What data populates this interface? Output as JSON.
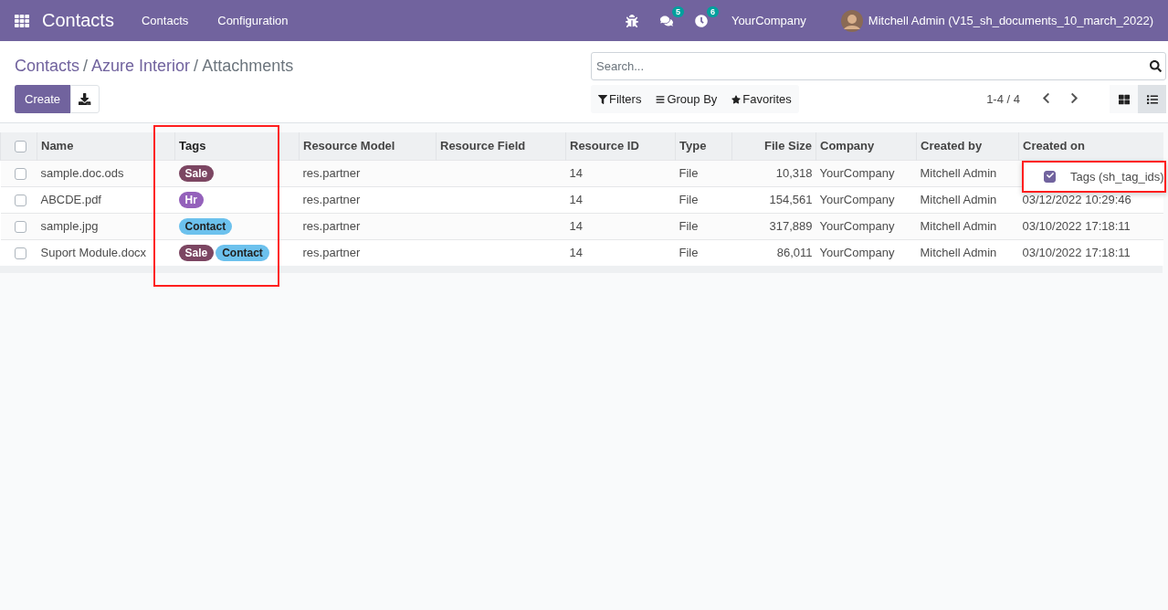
{
  "navbar": {
    "app_title": "Contacts",
    "menu": [
      "Contacts",
      "Configuration"
    ],
    "messages_badge": "5",
    "activities_badge": "6",
    "company": "YourCompany",
    "user": "Mitchell Admin (V15_sh_documents_10_march_2022)"
  },
  "breadcrumb": [
    {
      "label": "Contacts",
      "link": true
    },
    {
      "separator": "/",
      "label": "Azure Interior",
      "link": true
    },
    {
      "separator": "/",
      "label": "Attachments",
      "link": false
    }
  ],
  "create_button": "Create",
  "search": {
    "placeholder": "Search..."
  },
  "filters": [
    "Filters",
    "Group By",
    "Favorites"
  ],
  "pager": "1-4 / 4",
  "views": [
    {
      "kind": "kanban",
      "selected": false
    },
    {
      "kind": "list",
      "selected": true
    }
  ],
  "table": {
    "select_all": {
      "checked": false
    },
    "columns": [
      {
        "kind": "text",
        "label": "Name",
        "highlight": false
      },
      {
        "kind": "tags",
        "label": "Tags",
        "highlight": true
      },
      {
        "kind": "text",
        "label": "Resource Model",
        "highlight": false
      },
      {
        "kind": "text",
        "label": "Resource Field",
        "highlight": false
      },
      {
        "kind": "text",
        "label": "Resource ID",
        "highlight": false
      },
      {
        "kind": "text",
        "label": "Type",
        "highlight": false
      },
      {
        "kind": "number",
        "label": "File Size",
        "highlight": false
      },
      {
        "kind": "text",
        "label": "Company",
        "highlight": false
      },
      {
        "kind": "text",
        "label": "Created by",
        "highlight": false
      },
      {
        "kind": "text",
        "label": "Created on",
        "highlight": false
      }
    ],
    "rows": [
      {
        "checked": false,
        "cells": [
          "sample.doc.ods",
          [
            {
              "label": "Sale",
              "color": "#7c4662"
            }
          ],
          "res.partner",
          null,
          "14",
          "File",
          "10,318",
          "YourCompany",
          "Mitchell Admin",
          null
        ]
      },
      {
        "checked": false,
        "cells": [
          "ABCDE.pdf",
          [
            {
              "label": "Hr",
              "color": "#9461bb"
            }
          ],
          "res.partner",
          null,
          "14",
          "File",
          "154,561",
          "YourCompany",
          "Mitchell Admin",
          "03/12/2022 10:29:46"
        ]
      },
      {
        "checked": false,
        "cells": [
          "sample.jpg",
          [
            {
              "label": "Contact",
              "color": "#6cc1ed"
            }
          ],
          "res.partner",
          null,
          "14",
          "File",
          "317,889",
          "YourCompany",
          "Mitchell Admin",
          "03/10/2022 17:18:11"
        ]
      },
      {
        "checked": false,
        "cells": [
          "Suport Module.docx",
          [
            {
              "label": "Sale",
              "color": "#7c4662"
            },
            {
              "label": "Contact",
              "color": "#6cc1ed"
            }
          ],
          "res.partner",
          null,
          "14",
          "File",
          "86,011",
          "YourCompany",
          "Mitchell Admin",
          "03/10/2022 17:18:11"
        ]
      }
    ]
  },
  "optional_columns": {
    "highlight": true,
    "items": [
      {
        "label": "Tags (sh_tag_ids)",
        "checked": true
      }
    ]
  }
}
